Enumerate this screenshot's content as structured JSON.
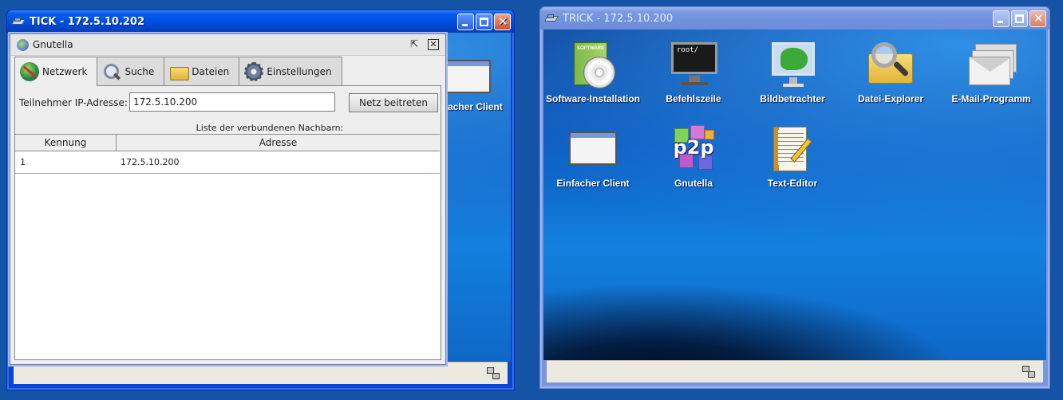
{
  "tick_window": {
    "title": "TICK - 172.5.10.202",
    "partial_icon_label": "acher Client",
    "gnutella": {
      "title": "Gnutella",
      "tabs": [
        {
          "label": "Netzwerk",
          "icon": "globe-icon"
        },
        {
          "label": "Suche",
          "icon": "magnifier-icon"
        },
        {
          "label": "Dateien",
          "icon": "folder-icon"
        },
        {
          "label": "Einstellungen",
          "icon": "gear-icon"
        }
      ],
      "ip_label": "Teilnehmer IP-Adresse:",
      "ip_value": "172.5.10.200",
      "join_button": "Netz beitreten",
      "list_caption": "Liste der verbundenen Nachbarn:",
      "columns": [
        "Kennung",
        "Adresse"
      ],
      "rows": [
        {
          "id": "1",
          "address": "172.5.10.200"
        }
      ]
    }
  },
  "trick_window": {
    "title": "TRICK - 172.5.10.200",
    "icons": [
      {
        "label": "Software-Installation",
        "icon": "software-cd-icon"
      },
      {
        "label": "Befehlszeile",
        "icon": "terminal-icon",
        "screen_text": "root/"
      },
      {
        "label": "Bildbetrachter",
        "icon": "image-viewer-icon"
      },
      {
        "label": "Datei-Explorer",
        "icon": "file-explorer-icon"
      },
      {
        "label": "E-Mail-Programm",
        "icon": "email-icon"
      },
      {
        "label": "Einfacher Client",
        "icon": "client-window-icon"
      },
      {
        "label": "Gnutella",
        "icon": "p2p-icon",
        "logo_text": "p2p"
      },
      {
        "label": "Text-Editor",
        "icon": "text-editor-icon"
      }
    ]
  }
}
